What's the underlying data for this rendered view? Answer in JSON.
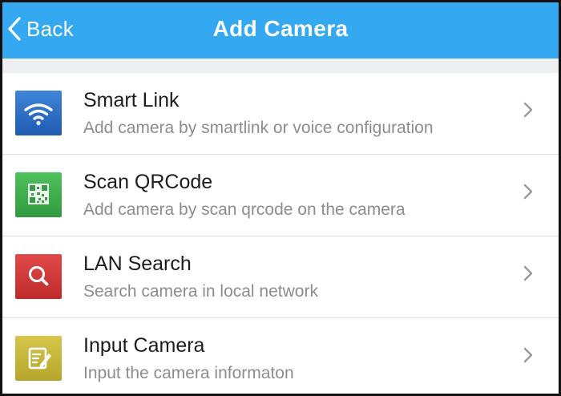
{
  "navbar": {
    "back_label": "Back",
    "title": "Add Camera",
    "background_color": "#34a9f2"
  },
  "options": [
    {
      "title": "Smart Link",
      "subtitle": "Add camera by smartlink or voice configuration",
      "icon": "wifi-icon",
      "color": "#2d6dc3"
    },
    {
      "title": "Scan QRCode",
      "subtitle": "Add camera by scan qrcode on the camera",
      "icon": "qr-code-icon",
      "color": "#3fae4e"
    },
    {
      "title": "LAN Search",
      "subtitle": "Search camera in local network",
      "icon": "search-icon",
      "color": "#d23a3a"
    },
    {
      "title": "Input Camera",
      "subtitle": "Input the camera informaton",
      "icon": "edit-note-icon",
      "color": "#c4b43a"
    }
  ]
}
